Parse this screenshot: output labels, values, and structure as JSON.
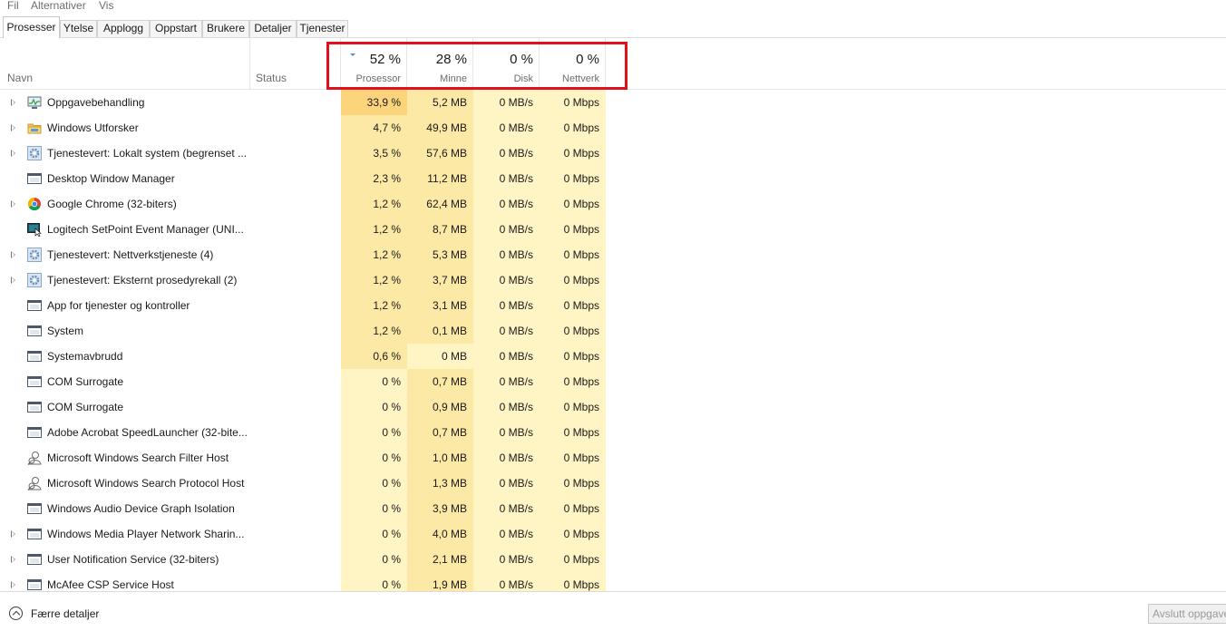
{
  "menu": [
    "Fil",
    "Alternativer",
    "Vis"
  ],
  "tabs": [
    "Prosesser",
    "Ytelse",
    "Applogg",
    "Oppstart",
    "Brukere",
    "Detaljer",
    "Tjenester"
  ],
  "active_tab": "Prosesser",
  "columns": {
    "name": "Navn",
    "status": "Status",
    "cpu": {
      "percent": "52 %",
      "label": "Prosessor"
    },
    "memory": {
      "percent": "28 %",
      "label": "Minne"
    },
    "disk": {
      "percent": "0 %",
      "label": "Disk"
    },
    "network": {
      "percent": "0 %",
      "label": "Nettverk"
    }
  },
  "colors": {
    "heat_high": "#fcd47c",
    "heat_mid": "#fde9a6",
    "heat_low": "#fff4c4",
    "highlight_box": "#e0101e"
  },
  "processes": [
    {
      "name": "Oppgavebehandling",
      "expand": true,
      "icon": "task-manager-icon",
      "cpu": "33,9 %",
      "mem": "5,2 MB",
      "disk": "0 MB/s",
      "net": "0 Mbps"
    },
    {
      "name": "Windows Utforsker",
      "expand": true,
      "icon": "folder-icon",
      "cpu": "4,7 %",
      "mem": "49,9 MB",
      "disk": "0 MB/s",
      "net": "0 Mbps"
    },
    {
      "name": "Tjenestevert: Lokalt system (begrenset ...",
      "expand": true,
      "icon": "gear-icon",
      "cpu": "3,5 %",
      "mem": "57,6 MB",
      "disk": "0 MB/s",
      "net": "0 Mbps"
    },
    {
      "name": "Desktop Window Manager",
      "expand": false,
      "icon": "window-icon",
      "cpu": "2,3 %",
      "mem": "11,2 MB",
      "disk": "0 MB/s",
      "net": "0 Mbps"
    },
    {
      "name": "Google Chrome (32-biters)",
      "expand": true,
      "icon": "chrome-icon",
      "cpu": "1,2 %",
      "mem": "62,4 MB",
      "disk": "0 MB/s",
      "net": "0 Mbps"
    },
    {
      "name": "Logitech SetPoint Event Manager (UNI...",
      "expand": false,
      "icon": "mouse-app-icon",
      "cpu": "1,2 %",
      "mem": "8,7 MB",
      "disk": "0 MB/s",
      "net": "0 Mbps"
    },
    {
      "name": "Tjenestevert: Nettverkstjeneste (4)",
      "expand": true,
      "icon": "gear-icon",
      "cpu": "1,2 %",
      "mem": "5,3 MB",
      "disk": "0 MB/s",
      "net": "0 Mbps"
    },
    {
      "name": "Tjenestevert: Eksternt prosedyrekall (2)",
      "expand": true,
      "icon": "gear-icon",
      "cpu": "1,2 %",
      "mem": "3,7 MB",
      "disk": "0 MB/s",
      "net": "0 Mbps"
    },
    {
      "name": "App for tjenester og kontroller",
      "expand": false,
      "icon": "window-icon",
      "cpu": "1,2 %",
      "mem": "3,1 MB",
      "disk": "0 MB/s",
      "net": "0 Mbps"
    },
    {
      "name": "System",
      "expand": false,
      "icon": "window-icon",
      "cpu": "1,2 %",
      "mem": "0,1 MB",
      "disk": "0 MB/s",
      "net": "0 Mbps"
    },
    {
      "name": "Systemavbrudd",
      "expand": false,
      "icon": "window-icon",
      "cpu": "0,6 %",
      "mem": "0 MB",
      "disk": "0 MB/s",
      "net": "0 Mbps"
    },
    {
      "name": "COM Surrogate",
      "expand": false,
      "icon": "window-icon",
      "cpu": "0 %",
      "mem": "0,7 MB",
      "disk": "0 MB/s",
      "net": "0 Mbps"
    },
    {
      "name": "COM Surrogate",
      "expand": false,
      "icon": "window-icon",
      "cpu": "0 %",
      "mem": "0,9 MB",
      "disk": "0 MB/s",
      "net": "0 Mbps"
    },
    {
      "name": "Adobe Acrobat SpeedLauncher (32-bite...",
      "expand": false,
      "icon": "window-icon",
      "cpu": "0 %",
      "mem": "0,7 MB",
      "disk": "0 MB/s",
      "net": "0 Mbps"
    },
    {
      "name": "Microsoft Windows Search Filter Host",
      "expand": false,
      "icon": "user-icon",
      "cpu": "0 %",
      "mem": "1,0 MB",
      "disk": "0 MB/s",
      "net": "0 Mbps"
    },
    {
      "name": "Microsoft Windows Search Protocol Host",
      "expand": false,
      "icon": "user-icon",
      "cpu": "0 %",
      "mem": "1,3 MB",
      "disk": "0 MB/s",
      "net": "0 Mbps"
    },
    {
      "name": "Windows Audio Device Graph Isolation",
      "expand": false,
      "icon": "window-icon",
      "cpu": "0 %",
      "mem": "3,9 MB",
      "disk": "0 MB/s",
      "net": "0 Mbps"
    },
    {
      "name": "Windows Media Player Network Sharin...",
      "expand": true,
      "icon": "window-icon",
      "cpu": "0 %",
      "mem": "4,0 MB",
      "disk": "0 MB/s",
      "net": "0 Mbps"
    },
    {
      "name": "User Notification Service (32-biters)",
      "expand": true,
      "icon": "window-icon",
      "cpu": "0 %",
      "mem": "2,1 MB",
      "disk": "0 MB/s",
      "net": "0 Mbps"
    },
    {
      "name": "McAfee CSP Service Host",
      "expand": true,
      "icon": "window-icon",
      "cpu": "0 %",
      "mem": "1,9 MB",
      "disk": "0 MB/s",
      "net": "0 Mbps"
    }
  ],
  "footer": {
    "fewer_details": "Færre detaljer",
    "end_task": "Avslutt oppgave"
  }
}
